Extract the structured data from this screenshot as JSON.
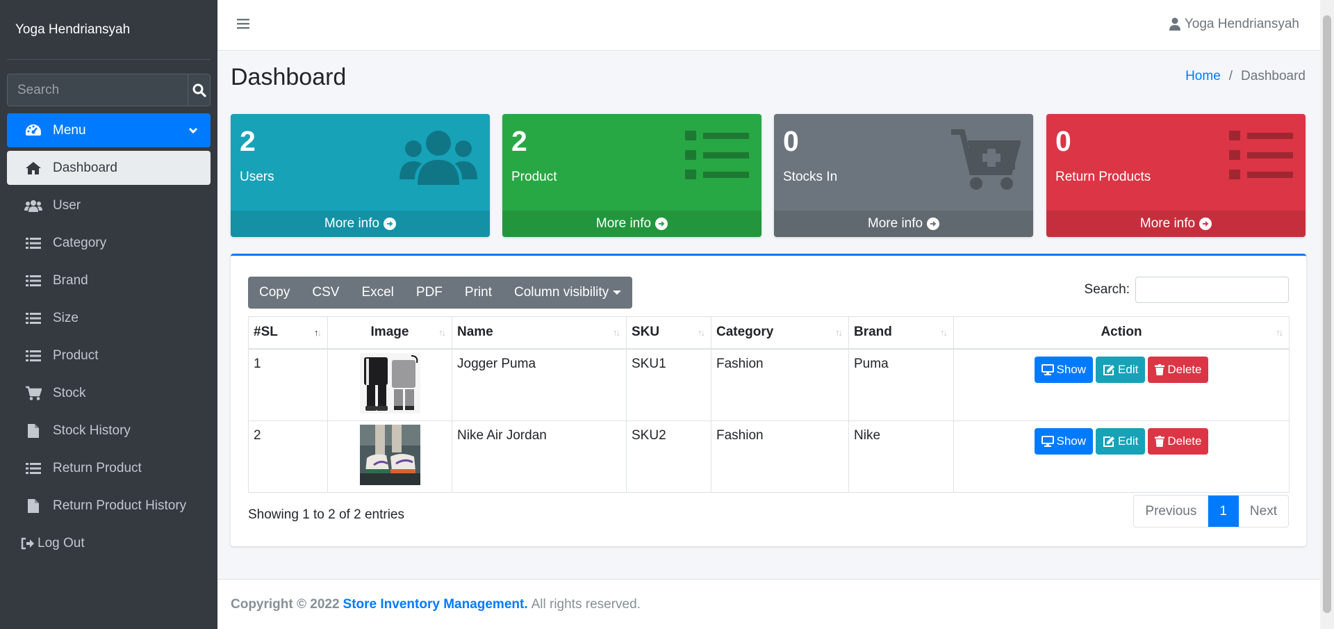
{
  "user_name": "Yoga Hendriansyah",
  "sidebar": {
    "search_placeholder": "Search",
    "menu_label": "Menu",
    "items": [
      {
        "label": "Dashboard",
        "icon": "home-icon"
      },
      {
        "label": "User",
        "icon": "users-icon"
      },
      {
        "label": "Category",
        "icon": "list-icon"
      },
      {
        "label": "Brand",
        "icon": "list-icon"
      },
      {
        "label": "Size",
        "icon": "list-icon"
      },
      {
        "label": "Product",
        "icon": "list-icon"
      },
      {
        "label": "Stock",
        "icon": "cart-icon"
      },
      {
        "label": "Stock History",
        "icon": "file-icon"
      },
      {
        "label": "Return Product",
        "icon": "list-icon"
      },
      {
        "label": "Return Product History",
        "icon": "file-icon"
      }
    ],
    "logout_label": "Log Out"
  },
  "header": {
    "title": "Dashboard",
    "breadcrumb_home": "Home",
    "breadcrumb_sep": "/",
    "breadcrumb_current": "Dashboard"
  },
  "boxes": [
    {
      "value": "2",
      "label": "Users",
      "more": "More info",
      "color": "#17a2b8"
    },
    {
      "value": "2",
      "label": "Product",
      "more": "More info",
      "color": "#28a745"
    },
    {
      "value": "0",
      "label": "Stocks In",
      "more": "More info",
      "color": "#6c757d"
    },
    {
      "value": "0",
      "label": "Return Products",
      "more": "More info",
      "color": "#dc3545"
    }
  ],
  "table": {
    "buttons": [
      "Copy",
      "CSV",
      "Excel",
      "PDF",
      "Print",
      "Column visibility"
    ],
    "search_label": "Search:",
    "columns": [
      "#SL",
      "Image",
      "Name",
      "SKU",
      "Category",
      "Brand",
      "Action"
    ],
    "rows": [
      {
        "sl": "1",
        "name": "Jogger Puma",
        "sku": "SKU1",
        "category": "Fashion",
        "brand": "Puma"
      },
      {
        "sl": "2",
        "name": "Nike Air Jordan",
        "sku": "SKU2",
        "category": "Fashion",
        "brand": "Nike"
      }
    ],
    "actions": {
      "show": "Show",
      "edit": "Edit",
      "delete": "Delete"
    },
    "info": "Showing 1 to 2 of 2 entries",
    "pager": {
      "prev": "Previous",
      "current": "1",
      "next": "Next"
    }
  },
  "footer": {
    "copyright": "Copyright © 2022",
    "app_name": "Store Inventory Management.",
    "rights": "All rights reserved."
  }
}
